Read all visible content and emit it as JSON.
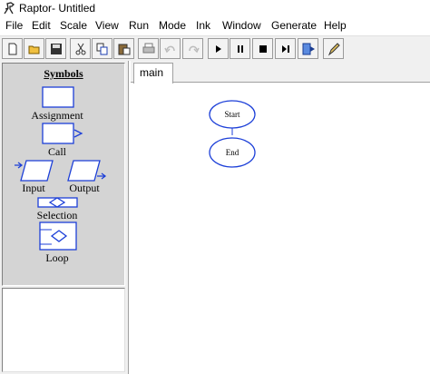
{
  "window": {
    "title": "Raptor- Untitled"
  },
  "icons": {
    "app": "raptor-icon",
    "toolbar": [
      "new-file-icon",
      "open-folder-icon",
      "save-icon",
      "cut-icon",
      "copy-icon",
      "paste-icon",
      "print-icon",
      "undo-icon",
      "redo-icon",
      "run-icon",
      "pause-icon",
      "stop-icon",
      "step-icon",
      "test-server-icon",
      "pen-icon"
    ]
  },
  "menu": [
    "File",
    "Edit",
    "Scale",
    "View",
    "Run",
    "Mode",
    "Ink",
    "Window",
    "Generate",
    "Help"
  ],
  "symbols": {
    "header": "Symbols",
    "assignment": "Assignment",
    "call": "Call",
    "input": "Input",
    "output": "Output",
    "selection": "Selection",
    "loop": "Loop"
  },
  "tabs": [
    "main"
  ],
  "flowchart": {
    "start": "Start",
    "end": "End"
  },
  "colors": {
    "symbol_stroke": "#1c3fd8",
    "panel_bg": "#f0f0f0",
    "symbols_bg": "#d4d4d4"
  }
}
